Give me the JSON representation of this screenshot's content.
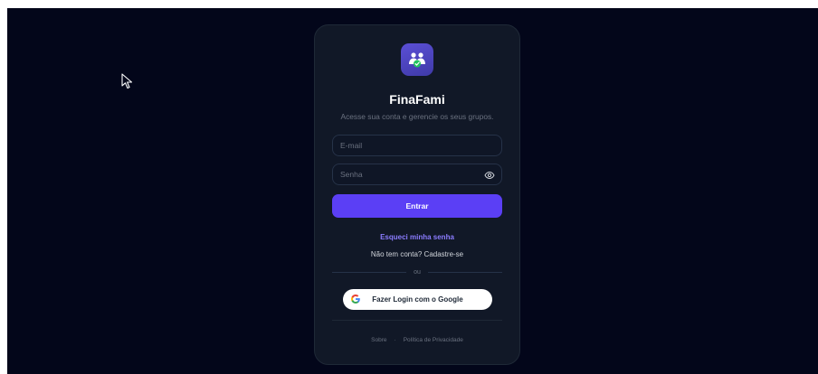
{
  "brand": {
    "name": "FinaFami",
    "tagline": "Acesse sua conta e gerencie os seus grupos.",
    "logo_icon": "family-users-icon",
    "accent": "#5b3ff5"
  },
  "form": {
    "email_placeholder": "E-mail",
    "password_placeholder": "Senha",
    "password_toggle_icon": "eye-icon",
    "submit_label": "Entrar"
  },
  "links": {
    "forgot": "Esqueci minha senha",
    "signup": "Não tem conta? Cadastre-se"
  },
  "divider_label": "ou",
  "google": {
    "label": "Fazer Login com o Google",
    "icon": "google-icon"
  },
  "footer": {
    "about": "Sobre",
    "separator": "·",
    "privacy": "Política de Privacidade"
  }
}
